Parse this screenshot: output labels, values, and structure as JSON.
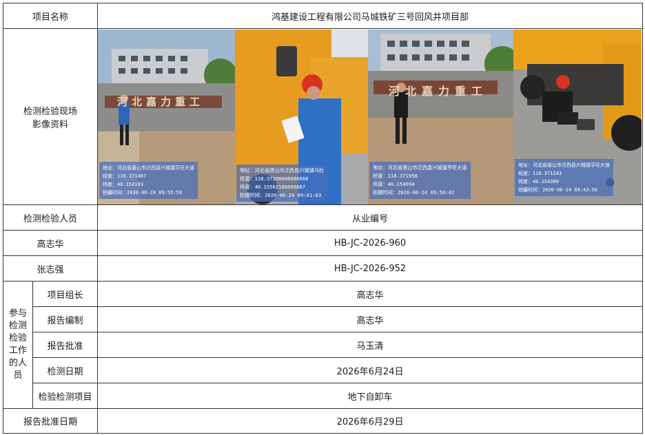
{
  "header": {
    "project_label": "项目名称",
    "project_name": "鸿基建设工程有限公司马城铁矿三号回风井项目部"
  },
  "photos_label_line1": "检测检验现场",
  "photos_label_line2": "影像资料",
  "photos": [
    {
      "sign_text": "河北嘉力重工",
      "stamp": [
        "地址：河北省唐山市迁西县兴城镇亨旺大道",
        "经度：118.371467",
        "纬度：40.154103",
        "拍摄时间：2026-06-24 09:55:59"
      ]
    },
    {
      "sign_text": "",
      "stamp": [
        "地址：河北省唐山市迁西县兴城镇马杜",
        "经度：118.37166666666666",
        "纬度：40.15562166666667",
        "拍摄时间：2026-06-24 09:41:03"
      ]
    },
    {
      "sign_text": "河北嘉力重工",
      "stamp": [
        "地址：河北省唐山市迁西县兴城镇亨旺大道",
        "经度：118.371958",
        "纬度：40.154094",
        "拍摄时间：2026-06-24 09:50:42"
      ]
    },
    {
      "sign_text": "",
      "stamp": [
        "地址：河北省唐山市迁西县兴城镇亨旺大道",
        "经度：118.371243",
        "纬度：40.154389",
        "拍摄时间：2026-06-24 09:43:58"
      ]
    }
  ],
  "personnel_header": {
    "label": "检测检验人员",
    "value": "从业编号"
  },
  "inspectors": [
    {
      "name": "高志华",
      "id": "HB-JC-2026-960"
    },
    {
      "name": "张志强",
      "id": "HB-JC-2026-952"
    }
  ],
  "participants_label": [
    "参与",
    "检测",
    "检验",
    "工作",
    "的人",
    "员"
  ],
  "participants": [
    {
      "role": "项目组长",
      "value": "高志华"
    },
    {
      "role": "报告编制",
      "value": "高志华"
    },
    {
      "role": "报告批准",
      "value": "马玉清"
    },
    {
      "role": "检测日期",
      "value": "2026年6月24日"
    },
    {
      "role": "检验检测项目",
      "value": "地下自卸车"
    }
  ],
  "approval": {
    "label": "报告批准日期",
    "value": "2026年6月29日"
  }
}
